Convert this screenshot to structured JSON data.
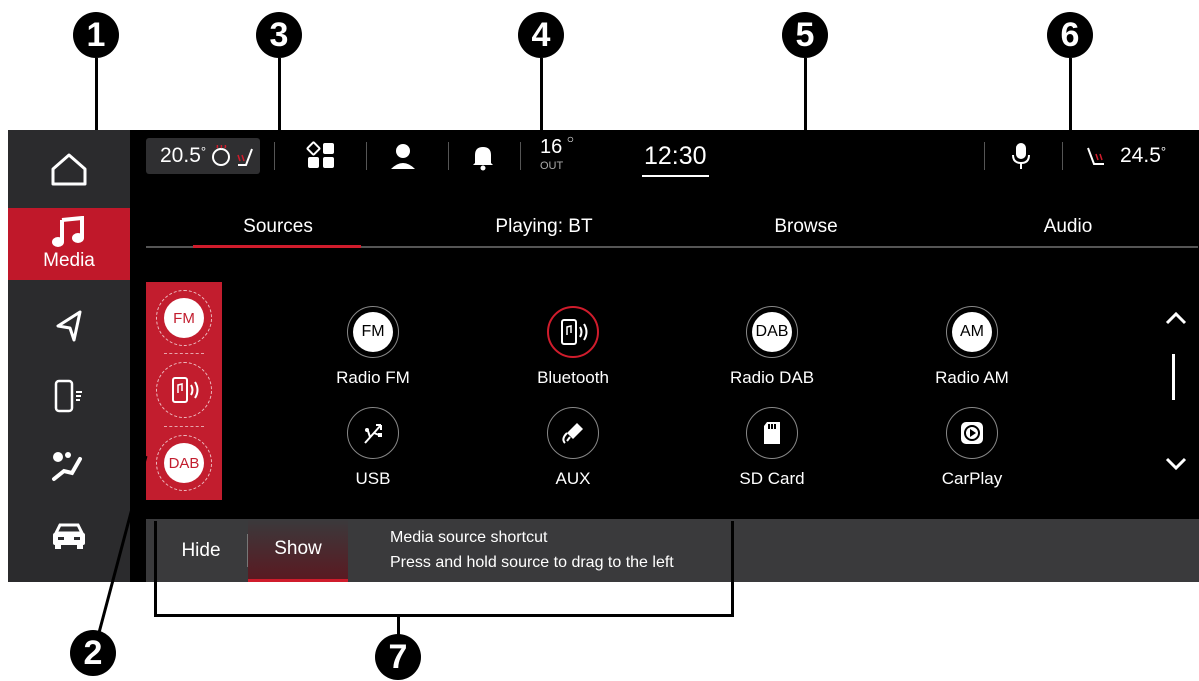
{
  "callouts": [
    "1",
    "2",
    "3",
    "4",
    "5",
    "6",
    "7"
  ],
  "status_bar": {
    "temp_left": "20.5",
    "temp_left_unit": "°",
    "outside_temp": "16",
    "outside_label": "OUT",
    "clock": "12:30",
    "temp_right": "24.5",
    "temp_right_unit": "°"
  },
  "sidebar": {
    "items": [
      {
        "name": "home",
        "icon": "home-icon",
        "label": ""
      },
      {
        "name": "media",
        "icon": "music-note-icon",
        "label": "Media"
      },
      {
        "name": "navigation",
        "icon": "navigation-arrow-icon",
        "label": ""
      },
      {
        "name": "phone",
        "icon": "phone-icon",
        "label": ""
      },
      {
        "name": "climate",
        "icon": "fan-seat-icon",
        "label": ""
      },
      {
        "name": "vehicle",
        "icon": "car-icon",
        "label": ""
      }
    ]
  },
  "tabs": [
    {
      "label": "Sources"
    },
    {
      "label": "Playing: BT"
    },
    {
      "label": "Browse"
    },
    {
      "label": "Audio"
    }
  ],
  "shortcuts": [
    {
      "label": "FM"
    },
    {
      "icon": "bluetooth-phone-icon"
    },
    {
      "label": "DAB"
    }
  ],
  "sources": [
    {
      "label": "Radio FM",
      "badge": "FM"
    },
    {
      "label": "Bluetooth",
      "icon": "bluetooth-phone-icon"
    },
    {
      "label": "Radio DAB",
      "badge": "DAB"
    },
    {
      "label": "Radio AM",
      "badge": "AM"
    },
    {
      "label": "USB",
      "icon": "usb-icon"
    },
    {
      "label": "AUX",
      "icon": "aux-icon"
    },
    {
      "label": "SD Card",
      "icon": "sd-card-icon"
    },
    {
      "label": "CarPlay",
      "icon": "carplay-icon"
    }
  ],
  "bottom_bar": {
    "hide_label": "Hide",
    "show_label": "Show",
    "hint_title": "Media source shortcut",
    "hint_text": "Press and hold source to drag to the left"
  },
  "colors": {
    "accent": "#c21d2e",
    "screen_bg": "#000000",
    "sidebar_bg": "#2b2b2d"
  }
}
